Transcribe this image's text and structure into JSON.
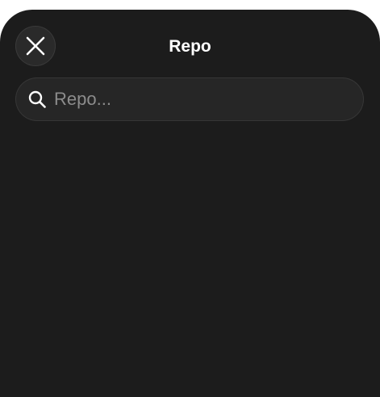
{
  "header": {
    "title": "Repo"
  },
  "search": {
    "placeholder": "Repo...",
    "value": ""
  },
  "icons": {
    "close": "close-icon",
    "search": "search-icon"
  },
  "colors": {
    "background": "#1c1c1c",
    "field": "#262626",
    "text": "#ffffff",
    "placeholder": "#8c8c8c"
  }
}
